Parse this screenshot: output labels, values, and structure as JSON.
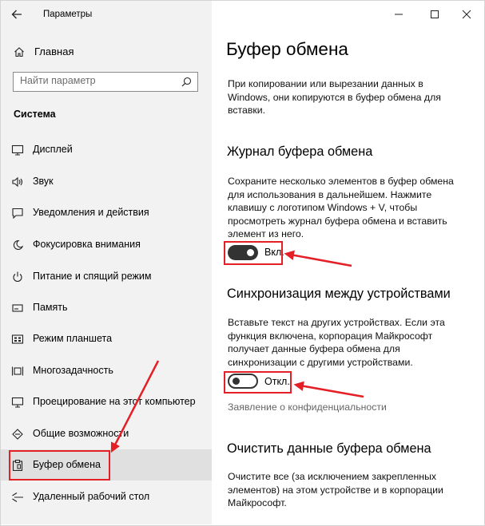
{
  "window": {
    "title": "Параметры",
    "controls": {
      "minimize": "minimize-icon",
      "maximize": "maximize-icon",
      "close": "close-icon"
    }
  },
  "sidebar": {
    "home_label": "Главная",
    "search_placeholder": "Найти параметр",
    "section_title": "Система",
    "items": [
      {
        "label": "Дисплей",
        "icon": "display-icon"
      },
      {
        "label": "Звук",
        "icon": "speaker-icon"
      },
      {
        "label": "Уведомления и действия",
        "icon": "notifications-icon"
      },
      {
        "label": "Фокусировка внимания",
        "icon": "focus-assist-icon"
      },
      {
        "label": "Питание и спящий режим",
        "icon": "power-icon"
      },
      {
        "label": "Память",
        "icon": "storage-icon"
      },
      {
        "label": "Режим планшета",
        "icon": "tablet-mode-icon"
      },
      {
        "label": "Многозадачность",
        "icon": "multitasking-icon"
      },
      {
        "label": "Проецирование на этот компьютер",
        "icon": "projecting-icon"
      },
      {
        "label": "Общие возможности",
        "icon": "shared-experiences-icon"
      },
      {
        "label": "Буфер обмена",
        "icon": "clipboard-icon",
        "selected": true
      },
      {
        "label": "Удаленный рабочий стол",
        "icon": "remote-desktop-icon"
      }
    ]
  },
  "main": {
    "title": "Буфер обмена",
    "intro": "При копировании или вырезании данных в Windows, они копируются в буфер обмена для вставки.",
    "history": {
      "heading": "Журнал буфера обмена",
      "description": "Сохраните несколько элементов в буфер обмена для использования в дальнейшем. Нажмите клавишу с логотипом Windows + V, чтобы просмотреть журнал буфера обмена и вставить элемент из него.",
      "toggle_state": "on",
      "toggle_label": "Вкл."
    },
    "sync": {
      "heading": "Синхронизация между устройствами",
      "description": "Вставьте текст на других устройствах. Если эта функция включена, корпорация Майкрософт получает данные буфера обмена для синхронизации с другими устройствами.",
      "toggle_state": "off",
      "toggle_label": "Откл.",
      "privacy_link": "Заявление о конфиденциальности"
    },
    "clear": {
      "heading": "Очистить данные буфера обмена",
      "description": "Очистите все (за исключением закрепленных элементов) на этом устройстве и в корпорации Майкрософт."
    }
  },
  "annotations": {
    "color": "#e41f26"
  }
}
